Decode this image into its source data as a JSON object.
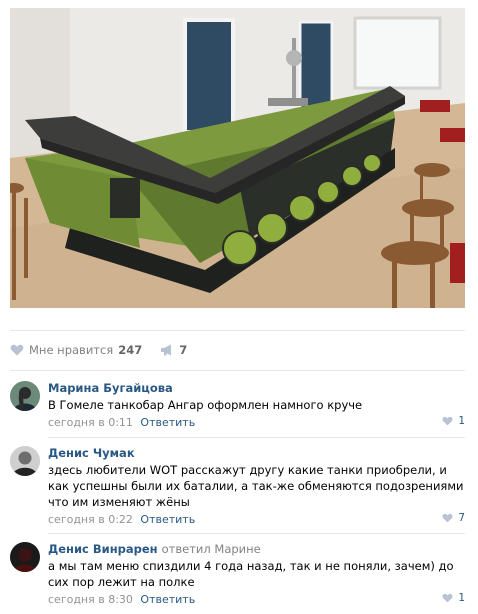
{
  "post": {
    "likes_label": "Мне нравится",
    "likes_count": "247",
    "shares_count": "7"
  },
  "comments": [
    {
      "author": "Марина Бугайцова",
      "reply_to": "",
      "text": "В Гомеле танкобар Ангар оформлен намного круче",
      "time": "сегодня в 0:11",
      "reply_label": "Ответить",
      "likes": "1"
    },
    {
      "author": "Денис Чумак",
      "reply_to": "",
      "text": "здесь любители WOT расскажут другу какие танки приобрели, и как успешны были их баталии, а так-же обменяются подозрениями что им изменяют жёны",
      "time": "сегодня в 0:22",
      "reply_label": "Ответить",
      "likes": "7"
    },
    {
      "author": "Денис Винрарен",
      "reply_to": "ответил Марине",
      "text": "а мы там меню спиздили 4 года назад, так и не поняли, зачем) до сих пор лежит на полке",
      "time": "сегодня в 8:30",
      "reply_label": "Ответить",
      "likes": "1"
    }
  ],
  "colors": {
    "link": "#2a5885",
    "meta": "#939393",
    "separator": "#e7e8ec",
    "icon": "#b7c3d2"
  },
  "icons": [
    "heart-icon",
    "megaphone-icon",
    "avatar"
  ]
}
